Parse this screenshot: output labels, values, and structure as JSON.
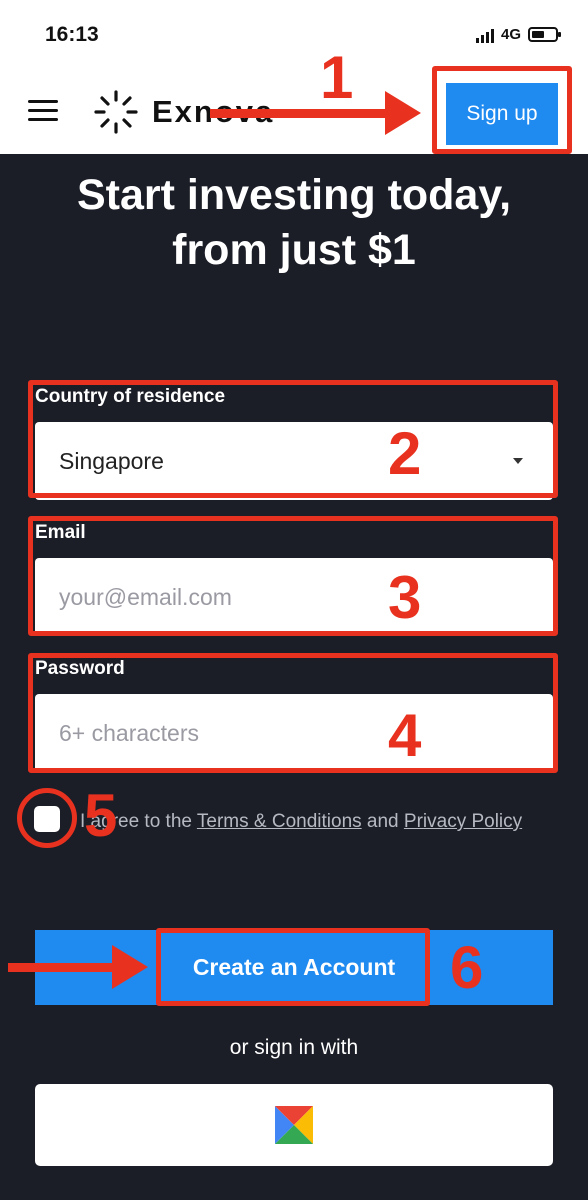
{
  "status_bar": {
    "time": "16:13",
    "network": "4G"
  },
  "header": {
    "brand": "Exnova",
    "signup_label": "Sign up"
  },
  "hero": {
    "line1": "Start investing today,",
    "line2": "from just $1"
  },
  "form": {
    "country": {
      "label": "Country of residence",
      "value": "Singapore"
    },
    "email": {
      "label": "Email",
      "placeholder": "your@email.com"
    },
    "password": {
      "label": "Password",
      "placeholder": "6+ characters"
    }
  },
  "terms": {
    "prefix": "I agree to the ",
    "terms_link": "Terms & Conditions",
    "middle": " and ",
    "privacy_link": "Privacy Policy",
    "checked": false
  },
  "create_account_label": "Create an Account",
  "alt_signin_text": "or sign in with",
  "annotations": {
    "n1": "1",
    "n2": "2",
    "n3": "3",
    "n4": "4",
    "n5": "5",
    "n6": "6"
  },
  "colors": {
    "accent": "#1f8af0",
    "annotation": "#e8321f",
    "background": "#1b1d27"
  },
  "icons": {
    "menu": "hamburger-icon",
    "logo": "exnova-logo",
    "google": "google-icon",
    "dropdown": "caret-down-icon"
  }
}
